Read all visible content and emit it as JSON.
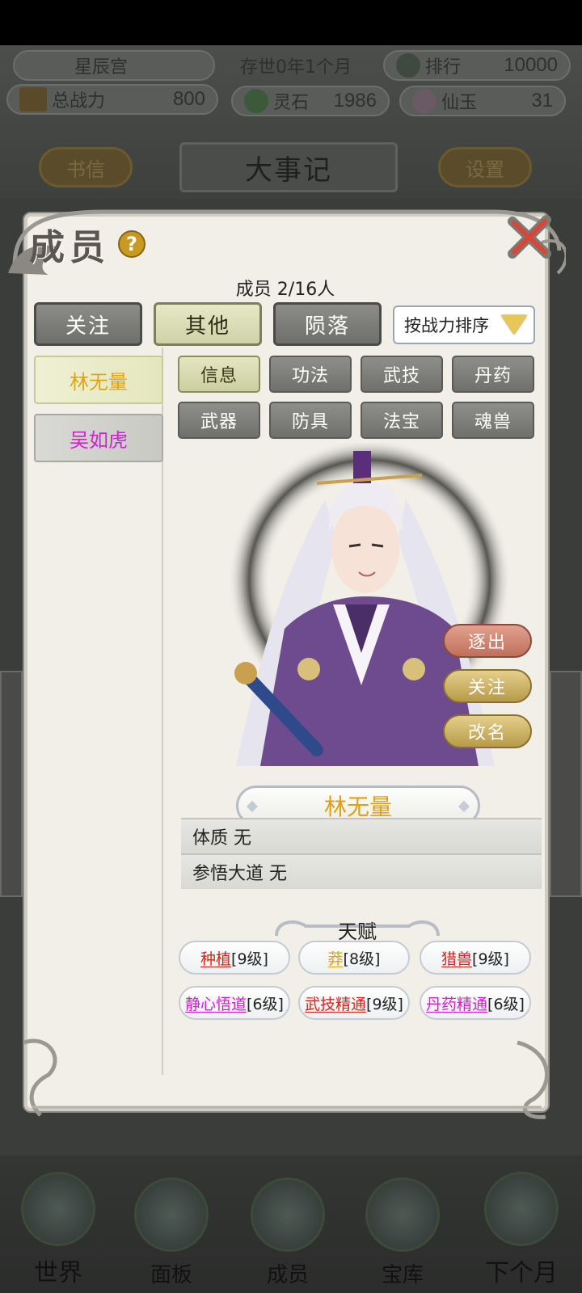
{
  "header": {
    "sect_name": "星辰宫",
    "time_label": "存世0年1个月",
    "rank_label": "排行",
    "rank_value": "10000",
    "power_label": "总战力",
    "power_value": "800",
    "spirit_stone_label": "灵石",
    "spirit_stone_value": "1986",
    "immortal_jade_label": "仙玉",
    "immortal_jade_value": "31",
    "letters_button": "书信",
    "page_title": "大事记",
    "settings_button": "设置"
  },
  "dialog": {
    "title": "成员",
    "help_icon": "?",
    "member_count": "成员  2/16人",
    "tabs": [
      {
        "label": "关注",
        "active": false
      },
      {
        "label": "其他",
        "active": true
      },
      {
        "label": "陨落",
        "active": false
      }
    ],
    "sort_label": "按战力排序",
    "members": [
      {
        "name": "林无量",
        "selected": true
      },
      {
        "name": "吴如虎",
        "selected": false
      }
    ],
    "subtabs": [
      {
        "label": "信息",
        "active": true
      },
      {
        "label": "功法",
        "active": false
      },
      {
        "label": "武技",
        "active": false
      },
      {
        "label": "丹药",
        "active": false
      },
      {
        "label": "武器",
        "active": false
      },
      {
        "label": "防具",
        "active": false
      },
      {
        "label": "法宝",
        "active": false
      },
      {
        "label": "魂兽",
        "active": false
      }
    ],
    "actions": {
      "expel": "逐出",
      "follow": "关注",
      "rename": "改名"
    },
    "character_name": "林无量",
    "info_rows": [
      {
        "text": "体质 无"
      },
      {
        "text": "参悟大道 无"
      }
    ],
    "talent_header": "天赋",
    "talents": [
      {
        "name": "种植",
        "level": "[9级]",
        "color": "#d8251a"
      },
      {
        "name": "莽",
        "level": "[8级]",
        "color": "#e0a010"
      },
      {
        "name": "猎兽",
        "level": "[9级]",
        "color": "#d8251a"
      },
      {
        "name": "静心悟道",
        "level": "[6级]",
        "color": "#d21fd2"
      },
      {
        "name": "武技精通",
        "level": "[9级]",
        "color": "#d8251a"
      },
      {
        "name": "丹药精通",
        "level": "[6级]",
        "color": "#d21fd2"
      }
    ]
  },
  "bottom_nav": [
    {
      "label": "世界",
      "icon": "world-icon"
    },
    {
      "label": "面板",
      "icon": "panel-icon"
    },
    {
      "label": "成员",
      "icon": "member-icon"
    },
    {
      "label": "宝库",
      "icon": "treasury-icon"
    },
    {
      "label": "下个月",
      "icon": "next-month-icon"
    }
  ]
}
